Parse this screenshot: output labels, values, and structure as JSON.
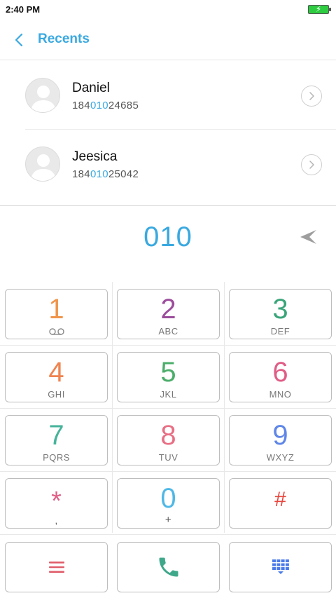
{
  "status_bar": {
    "time": "2:40 PM",
    "battery_icon": "battery-charging-icon"
  },
  "header": {
    "title": "Recents",
    "back_icon": "chevron-left-icon"
  },
  "recents": [
    {
      "name": "Daniel",
      "number_pre": "184",
      "number_match": "010",
      "number_post": "24685"
    },
    {
      "name": "Jeesica",
      "number_pre": "184",
      "number_match": "010",
      "number_post": "25042"
    }
  ],
  "dialer": {
    "input": "010",
    "delete_icon": "backspace-arrow-icon"
  },
  "keys": [
    {
      "digit": "1",
      "letters": "",
      "sub_icon": "voicemail-icon",
      "color": "#f0954b"
    },
    {
      "digit": "2",
      "letters": "ABC",
      "color": "#9c4d9c"
    },
    {
      "digit": "3",
      "letters": "DEF",
      "color": "#3aa57a"
    },
    {
      "digit": "4",
      "letters": "GHI",
      "color": "#ef8450"
    },
    {
      "digit": "5",
      "letters": "JKL",
      "color": "#4cae6b"
    },
    {
      "digit": "6",
      "letters": "MNO",
      "color": "#e05d86"
    },
    {
      "digit": "7",
      "letters": "PQRS",
      "color": "#46b39a"
    },
    {
      "digit": "8",
      "letters": "TUV",
      "color": "#e86f84"
    },
    {
      "digit": "9",
      "letters": "WXYZ",
      "color": "#5f86e8"
    },
    {
      "digit": "*",
      "letters": ",",
      "color": "#e05d86"
    },
    {
      "digit": "0",
      "letters": "+",
      "color": "#4fb8e6"
    },
    {
      "digit": "#",
      "letters": "",
      "color": "#e8453c"
    }
  ],
  "actions": {
    "menu_icon": "menu-icon",
    "menu_color": "#e05d6a",
    "call_icon": "phone-icon",
    "call_color": "#3fa88a",
    "keypad_icon": "dialpad-icon",
    "keypad_color": "#4a7be8"
  }
}
